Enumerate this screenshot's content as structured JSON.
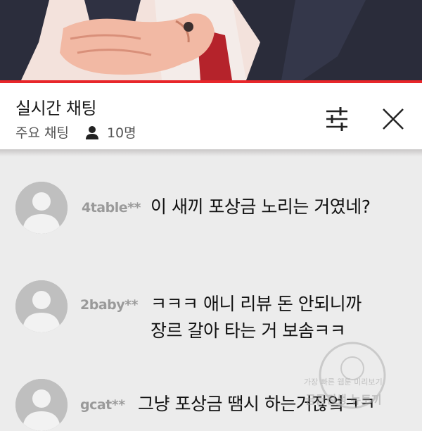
{
  "header": {
    "title": "실시간 채팅",
    "subtitle": "주요 채팅",
    "participant_count": "10명"
  },
  "icons": {
    "person": "person-icon",
    "filter": "sliders-icon",
    "close": "close-icon"
  },
  "colors": {
    "accent_red": "#e8262a",
    "background": "#ececec",
    "username": "#9a9a9a"
  },
  "messages": [
    {
      "author": "4table**",
      "lines": [
        "이 새끼 포상금 노리는 거였네?"
      ]
    },
    {
      "author": "2baby**",
      "lines": [
        "ㅋㅋㅋ 애니 리뷰 돈 안되니까",
        "장르 갈아 타는 거 보솜ㅋㅋ"
      ]
    },
    {
      "author": "gcat**",
      "lines": [
        "그냥 포상금 땜시 하는거잖엌ㅋㅋ"
      ]
    }
  ],
  "watermark": {
    "line1": "가장 빠른 웹툰 미리보기",
    "line2": "금금전생 뉴토끼"
  }
}
